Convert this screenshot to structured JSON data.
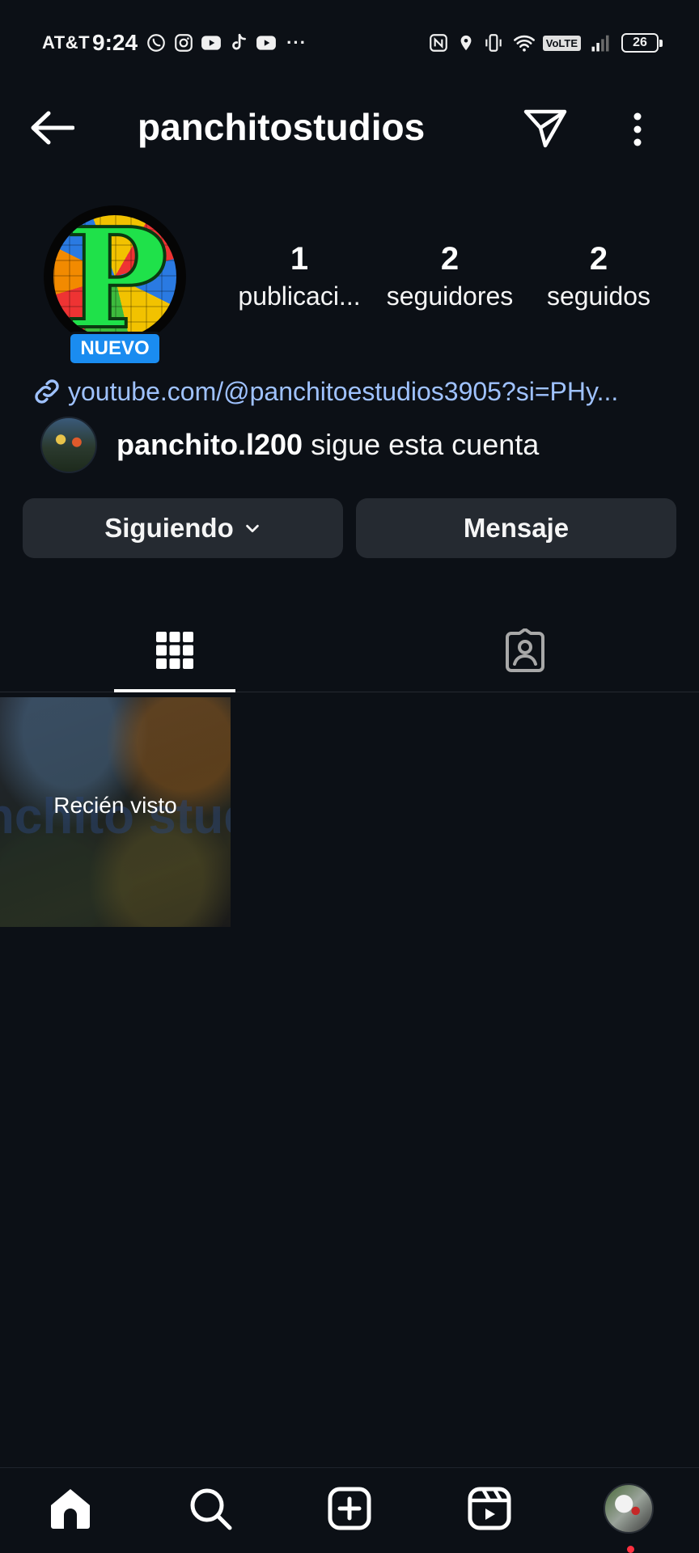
{
  "status_bar": {
    "carrier": "AT&T",
    "time": "9:24",
    "notification_icons": [
      "whatsapp-icon",
      "instagram-icon",
      "youtube-icon",
      "tiktok-icon",
      "youtube-icon"
    ],
    "more": "···",
    "volte": "VoLTE",
    "battery": "26"
  },
  "header": {
    "username": "panchitostudios",
    "icons": [
      "back-arrow-icon",
      "send-icon",
      "more-vertical-icon"
    ]
  },
  "profile": {
    "new_badge": "NUEVO",
    "stats": {
      "posts": {
        "count": "1",
        "label": "publicaci..."
      },
      "followers": {
        "count": "2",
        "label": "seguidores"
      },
      "following": {
        "count": "2",
        "label": "seguidos"
      }
    },
    "website": "youtube.com/@panchitoestudios3905?si=PHy...",
    "followed_by": {
      "username": "panchito.l200",
      "suffix": " sigue esta cuenta"
    }
  },
  "actions": {
    "following_label": "Siguiendo",
    "message_label": "Mensaje"
  },
  "tabs": [
    {
      "name": "grid",
      "icon": "grid-icon",
      "active": true
    },
    {
      "name": "tagged",
      "icon": "tagged-person-icon",
      "active": false
    }
  ],
  "posts": [
    {
      "overlay_label": "Recién visto",
      "watermark": "nchito studi"
    }
  ],
  "bottom_nav": {
    "items": [
      "home-icon",
      "search-icon",
      "create-icon",
      "reels-icon",
      "profile-avatar"
    ],
    "colors": {
      "notification_dot": "#ff3040",
      "badge": "#1a8cf0",
      "link": "#9fc2ff"
    }
  }
}
